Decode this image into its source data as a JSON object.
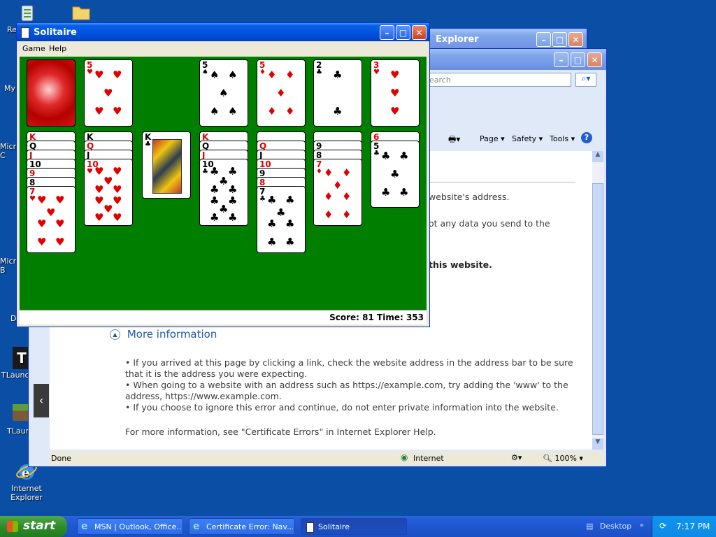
{
  "desktop": {
    "icons": [
      {
        "label": "Re"
      },
      {
        "label": ""
      },
      {
        "label": "My"
      },
      {
        "label": "Micro C"
      },
      {
        "label": "Micro B"
      },
      {
        "label": "D"
      },
      {
        "label": "TLaunch"
      },
      {
        "label": "TLaun"
      },
      {
        "label": "Internet Explorer"
      }
    ]
  },
  "ie_back": {
    "title": "Explorer"
  },
  "ie_front": {
    "search_placeholder": "earch",
    "toolbar": {
      "page": "Page",
      "safety": "Safety",
      "tools": "Tools"
    },
    "body": {
      "line1": "website's address.",
      "line2": "ot any data you send to the",
      "line3": "this website.",
      "more_info": "More information",
      "bullets": [
        "•  If you arrived at this page by clicking a link, check the website address in the address bar to be sure",
        "that it is the address you were expecting.",
        "•  When going to a website with an address such as https://example.com, try adding the 'www' to the",
        "address, https://www.example.com.",
        "•  If you choose to ignore this error and continue, do not enter private information into the website."
      ],
      "footer": "For more information, see \"Certificate Errors\" in Internet Explorer Help."
    },
    "status": {
      "left": "Done",
      "zone": "Internet",
      "zoom": "100%"
    }
  },
  "solitaire": {
    "title": "Solitaire",
    "menu": {
      "game": "Game",
      "help": "Help"
    },
    "status": "Score: 81  Time: 353",
    "foundations": [
      {
        "rank": "5",
        "suit": "♠",
        "color": "blk"
      },
      {
        "rank": "5",
        "suit": "♦",
        "color": "red"
      },
      {
        "rank": "2",
        "suit": "♣",
        "color": "blk"
      },
      {
        "rank": "3",
        "suit": "♥",
        "color": "red"
      }
    ],
    "waste": {
      "rank": "5",
      "suit": "♥",
      "color": "red"
    },
    "tableau": [
      {
        "stack": [
          [
            "K",
            "red"
          ],
          [
            "Q",
            "blk"
          ],
          [
            "J",
            "red"
          ],
          [
            "10",
            "blk"
          ],
          [
            "9",
            "red"
          ],
          [
            "8",
            "blk"
          ]
        ],
        "top": {
          "rank": "7",
          "suit": "♥",
          "color": "red"
        }
      },
      {
        "stack": [
          [
            "K",
            "blk"
          ],
          [
            "Q",
            "red"
          ],
          [
            "J",
            "blk"
          ]
        ],
        "top": {
          "rank": "10",
          "suit": "♥",
          "color": "red"
        }
      },
      {
        "stack": [],
        "top": {
          "rank": "K",
          "suit": "♣",
          "color": "blk"
        }
      },
      {
        "stack": [
          [
            "K",
            "red"
          ],
          [
            "Q",
            "blk"
          ],
          [
            "J",
            "red"
          ]
        ],
        "top": {
          "rank": "10",
          "suit": "♣",
          "color": "blk"
        }
      },
      {
        "stack": [
          [
            "",
            "blk"
          ],
          [
            "Q",
            "red"
          ],
          [
            "J",
            "blk"
          ],
          [
            "10",
            "red"
          ],
          [
            "9",
            "blk"
          ],
          [
            "8",
            "red"
          ]
        ],
        "top": {
          "rank": "7",
          "suit": "♣",
          "color": "blk"
        }
      },
      {
        "stack": [
          [
            "",
            "blk"
          ],
          [
            "9",
            "blk"
          ],
          [
            "8",
            "blk"
          ]
        ],
        "top": {
          "rank": "7",
          "suit": "♦",
          "color": "red"
        }
      },
      {
        "stack": [
          [
            "6",
            "red"
          ]
        ],
        "top": {
          "rank": "5",
          "suit": "♣",
          "color": "blk"
        }
      }
    ]
  },
  "taskbar": {
    "start": "start",
    "buttons": [
      {
        "label": "MSN | Outlook, Office..."
      },
      {
        "label": "Certificate Error: Nav..."
      },
      {
        "label": "Solitaire"
      }
    ],
    "desktop_label": "Desktop",
    "clock": "7:17 PM"
  }
}
